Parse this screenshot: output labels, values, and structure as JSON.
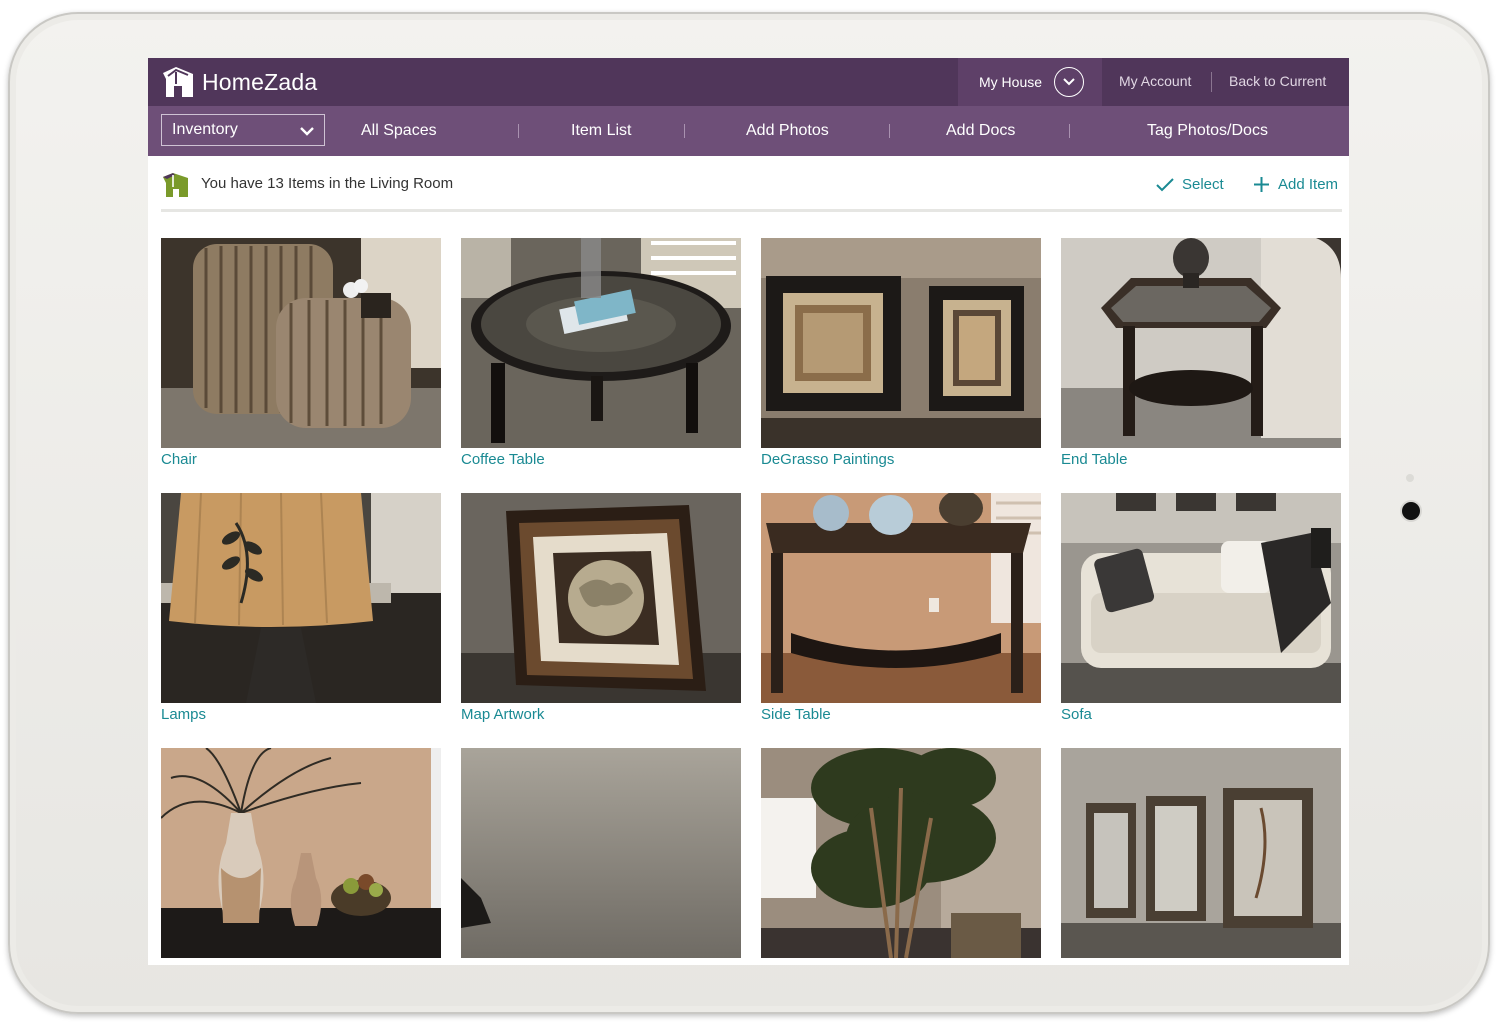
{
  "app": {
    "logo_text": "HomeZada"
  },
  "header": {
    "house_select": "My House",
    "my_account": "My Account",
    "back_to_current": "Back to Current"
  },
  "nav": {
    "section_select": "Inventory",
    "items": [
      {
        "label": "All Spaces"
      },
      {
        "label": "Item List"
      },
      {
        "label": "Add Photos"
      },
      {
        "label": "Add Docs"
      },
      {
        "label": "Tag Photos/Docs"
      }
    ]
  },
  "toolbar": {
    "info": "You have 13 Items in the Living Room",
    "select_label": "Select",
    "add_item_label": "Add Item"
  },
  "items": [
    {
      "label": "Chair",
      "photo": "striped-armchair"
    },
    {
      "label": "Coffee Table",
      "photo": "round-glass-coffee-table"
    },
    {
      "label": "DeGrasso Paintings",
      "photo": "two-framed-paintings"
    },
    {
      "label": "End Table",
      "photo": "octagonal-end-table"
    },
    {
      "label": "Lamps",
      "photo": "table-lamp"
    },
    {
      "label": "Map Artwork",
      "photo": "framed-map"
    },
    {
      "label": "Side Table",
      "photo": "console-side-table"
    },
    {
      "label": "Sofa",
      "photo": "white-sofa"
    },
    {
      "label": "",
      "photo": "vases-with-grass"
    },
    {
      "label": "",
      "photo": "carpet"
    },
    {
      "label": "",
      "photo": "potted-tree"
    },
    {
      "label": "",
      "photo": "three-mirrors"
    }
  ],
  "colors": {
    "top_bar": "#50365a",
    "nav_bar": "#6e4f78",
    "accent_link": "#1a8a93"
  }
}
